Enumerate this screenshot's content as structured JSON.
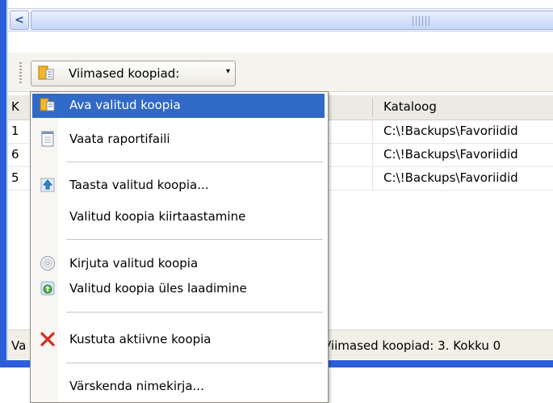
{
  "toolbar": {
    "recent_label": "Viimased koopiad:",
    "recent_caret": "▾"
  },
  "list": {
    "header": {
      "col_k": "K",
      "col_kataloog": "Kataloog"
    },
    "rows": [
      {
        "k": "1",
        "kataloog": "C:\\!Backups\\Favoriidid"
      },
      {
        "k": "6",
        "kataloog": "C:\\!Backups\\Favoriidid"
      },
      {
        "k": "5",
        "kataloog": "C:\\!Backups\\Favoriidid"
      }
    ]
  },
  "statusbar": {
    "left_fragment": "Va",
    "right_text": "Viimased koopiad: 3.  Kokku 0"
  },
  "menu": {
    "items": [
      {
        "label": "Ava valitud koopia",
        "icon": "folder-open-icon",
        "selected": true
      },
      {
        "label": "Vaata raportifaili",
        "icon": "report-file-icon"
      },
      {
        "label": "Taasta valitud koopia...",
        "icon": "restore-icon"
      },
      {
        "label": "Valitud koopia kiirtaastamine",
        "icon": ""
      },
      {
        "label": "Kirjuta valitud koopia",
        "icon": "cd-burn-icon"
      },
      {
        "label": "Valitud koopia üles laadimine",
        "icon": "upload-icon"
      },
      {
        "label": "Kustuta aktiivne koopia",
        "icon": "delete-x-icon"
      },
      {
        "label": "Värskenda nimekirja...",
        "icon": ""
      }
    ]
  },
  "colors": {
    "selection": "#3169c6",
    "window_frame": "#2b5fd9",
    "delete_icon": "#d62c1f"
  }
}
